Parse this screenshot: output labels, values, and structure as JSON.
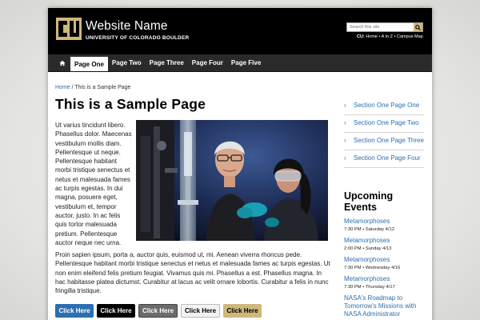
{
  "header": {
    "site_name": "Website Name",
    "site_sub": "UNIVERSITY OF COLORADO BOULDER",
    "search_placeholder": "Search this site",
    "util_prefix": "CU:",
    "util_links": [
      "Home",
      "A to Z",
      "Campus Map"
    ],
    "util_sep": " • "
  },
  "nav": {
    "home_icon": "home-icon",
    "items": [
      {
        "label": "Page One",
        "active": true
      },
      {
        "label": "Page Two"
      },
      {
        "label": "Page Three"
      },
      {
        "label": "Page Four"
      },
      {
        "label": "Page Five"
      }
    ]
  },
  "breadcrumb": {
    "home": "Home",
    "sep": " / ",
    "current": "This is a Sample Page"
  },
  "main": {
    "title": "This is a Sample Page",
    "para_left": "Ut varius tincidunt libero. Phasellus dolor. Maecenas vestibulum mollis diam. Pellentesque ut neque. Pellentesque habitant morbi tristique senectus et netus et malesuada fames ac turpis egestas. In dui magna, posuere eget, vestibulum et, tempor auctor, justo. In ac felis quis tortor malesuada pretium. Pellentesque auctor neque nec urna.",
    "para_full": "Proin sapien ipsum, porta a, auctor quis, euismod ut, mi. Aenean viverra rhoncus pede. Pellentesque habitant morbi tristique senectus et netus et malesuada fames ac turpis egestas. Ut non enim eleifend felis pretium feugiat. Vivamus quis mi. Phasellus a est. Phasellus magna. In hac habitasse platea dictumst. Curabitur at lacus ac velit ornare lobortis. Curabitur a felis in nunc fringilla tristique.",
    "buttons": [
      "Click Here",
      "Click Here",
      "Click Here",
      "Click Here",
      "Click Here"
    ]
  },
  "sidebar": {
    "links": [
      "Section One Page One",
      "Section One Page Two",
      "Section One Page Three",
      "Section One Page Four"
    ],
    "chevron": "›",
    "upcoming_title": "Upcoming Events",
    "events": [
      {
        "title": "Metamorphoses",
        "meta": "7:30 PM • Saturday 4/12"
      },
      {
        "title": "Metamorphoses",
        "meta": "2:00 PM • Sunday 4/13"
      },
      {
        "title": "Metamorphoses",
        "meta": "7:30 PM • Wednesday 4/16"
      },
      {
        "title": "Metamorphoses",
        "meta": "7:30 PM • Thursday 4/17"
      },
      {
        "title": "NASA's Roadmap to Tomorrow's Missions with NASA Administrator",
        "meta": ""
      }
    ]
  },
  "colors": {
    "link": "#2b6fb0",
    "gold": "#cfb87c",
    "header_bg": "#000000",
    "nav_bg": "#2a2a2a"
  }
}
